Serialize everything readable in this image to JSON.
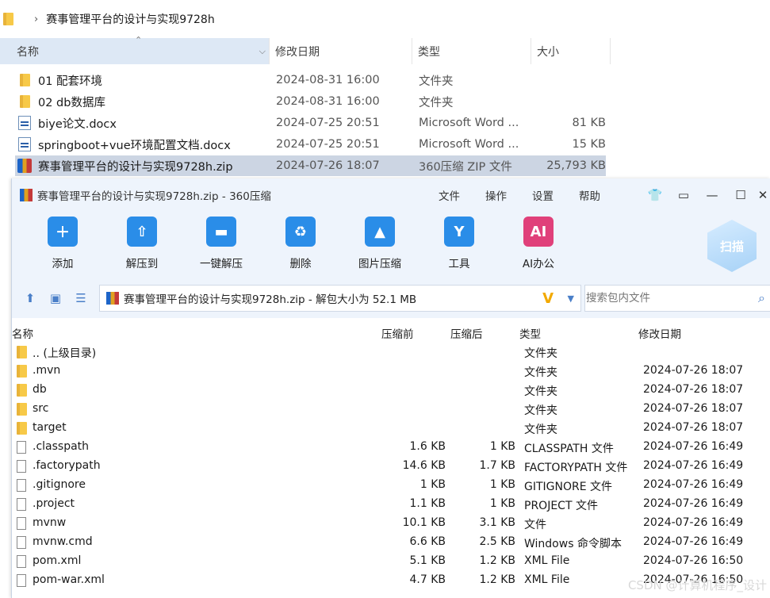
{
  "explorer": {
    "breadcrumb": "赛事管理平台的设计与实现9728h",
    "columns": {
      "name": "名称",
      "date": "修改日期",
      "type": "类型",
      "size": "大小"
    },
    "rows": [
      {
        "name": "01 配套环境",
        "date": "2024-08-31 16:00",
        "type": "文件夹",
        "size": "",
        "icon": "folder-icon"
      },
      {
        "name": "02 db数据库",
        "date": "2024-08-31 16:00",
        "type": "文件夹",
        "size": "",
        "icon": "folder-icon"
      },
      {
        "name": "biye论文.docx",
        "date": "2024-07-25 20:51",
        "type": "Microsoft Word ...",
        "size": "81 KB",
        "icon": "word-doc-icon"
      },
      {
        "name": "springboot+vue环境配置文档.docx",
        "date": "2024-07-25 20:51",
        "type": "Microsoft Word ...",
        "size": "15 KB",
        "icon": "word-doc-icon"
      },
      {
        "name": "赛事管理平台的设计与实现9728h.zip",
        "date": "2024-07-26 18:07",
        "type": "360压缩 ZIP 文件",
        "size": "25,793 KB",
        "icon": "zip-icon",
        "selected": true
      }
    ]
  },
  "zip_window": {
    "title": "赛事管理平台的设计与实现9728h.zip - 360压缩",
    "menu": [
      "文件",
      "操作",
      "设置",
      "帮助"
    ],
    "tools": [
      {
        "label": "添加",
        "icon": "add-icon",
        "color": "#2a8de8"
      },
      {
        "label": "解压到",
        "icon": "extract-to-icon",
        "color": "#2a8de8"
      },
      {
        "label": "一键解压",
        "icon": "one-click-extract-icon",
        "color": "#2a8de8"
      },
      {
        "label": "删除",
        "icon": "delete-icon",
        "color": "#2a8de8"
      },
      {
        "label": "图片压缩",
        "icon": "image-compress-icon",
        "color": "#2a8de8"
      },
      {
        "label": "工具",
        "icon": "tools-icon",
        "color": "#2a8de8"
      },
      {
        "label": "AI办公",
        "icon": "ai-office-icon",
        "color": "#e0407a"
      }
    ],
    "scan_label": "扫描",
    "address": "赛事管理平台的设计与实现9728h.zip - 解包大小为 52.1 MB",
    "search_placeholder": "搜索包内文件",
    "columns": {
      "name": "名称",
      "packed": "压缩前",
      "compressed": "压缩后",
      "type": "类型",
      "date": "修改日期"
    },
    "rows": [
      {
        "name": ".. (上级目录)",
        "packed": "",
        "compressed": "",
        "type": "文件夹",
        "date": "",
        "kind": "folder"
      },
      {
        "name": ".mvn",
        "packed": "",
        "compressed": "",
        "type": "文件夹",
        "date": "2024-07-26 18:07",
        "kind": "folder"
      },
      {
        "name": "db",
        "packed": "",
        "compressed": "",
        "type": "文件夹",
        "date": "2024-07-26 18:07",
        "kind": "folder"
      },
      {
        "name": "src",
        "packed": "",
        "compressed": "",
        "type": "文件夹",
        "date": "2024-07-26 18:07",
        "kind": "folder"
      },
      {
        "name": "target",
        "packed": "",
        "compressed": "",
        "type": "文件夹",
        "date": "2024-07-26 18:07",
        "kind": "folder"
      },
      {
        "name": ".classpath",
        "packed": "1.6 KB",
        "compressed": "1 KB",
        "type": "CLASSPATH 文件",
        "date": "2024-07-26 16:49",
        "kind": "file"
      },
      {
        "name": ".factorypath",
        "packed": "14.6 KB",
        "compressed": "1.7 KB",
        "type": "FACTORYPATH 文件",
        "date": "2024-07-26 16:49",
        "kind": "file"
      },
      {
        "name": ".gitignore",
        "packed": "1 KB",
        "compressed": "1 KB",
        "type": "GITIGNORE 文件",
        "date": "2024-07-26 16:49",
        "kind": "file"
      },
      {
        "name": ".project",
        "packed": "1.1 KB",
        "compressed": "1 KB",
        "type": "PROJECT 文件",
        "date": "2024-07-26 16:49",
        "kind": "file"
      },
      {
        "name": "mvnw",
        "packed": "10.1 KB",
        "compressed": "3.1 KB",
        "type": "文件",
        "date": "2024-07-26 16:49",
        "kind": "file"
      },
      {
        "name": "mvnw.cmd",
        "packed": "6.6 KB",
        "compressed": "2.5 KB",
        "type": "Windows 命令脚本",
        "date": "2024-07-26 16:49",
        "kind": "file"
      },
      {
        "name": "pom.xml",
        "packed": "5.1 KB",
        "compressed": "1.2 KB",
        "type": "XML File",
        "date": "2024-07-26 16:50",
        "kind": "file"
      },
      {
        "name": "pom-war.xml",
        "packed": "4.7 KB",
        "compressed": "1.2 KB",
        "type": "XML File",
        "date": "2024-07-26 16:50",
        "kind": "file"
      }
    ]
  },
  "watermark": "CSDN @计算机程序_设计"
}
